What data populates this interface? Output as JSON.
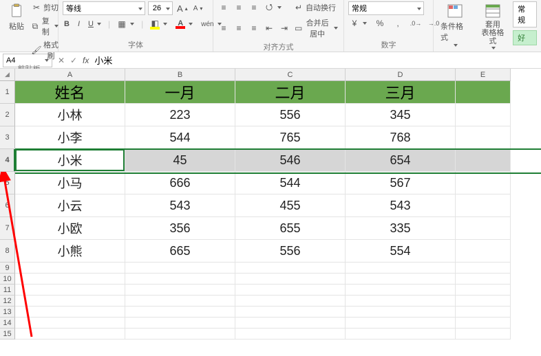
{
  "ribbon": {
    "clipboard": {
      "cut": "剪切",
      "copy": "复制",
      "format_painter": "格式刷",
      "paste": "粘贴",
      "group_label": "剪贴板"
    },
    "font": {
      "name": "等线",
      "size": "26",
      "bold": "B",
      "italic": "I",
      "underline": "U",
      "inc_font_tip": "A",
      "dec_font_tip": "A",
      "group_label": "字体"
    },
    "alignment": {
      "wrap_text": "自动换行",
      "merge_center": "合并后居中",
      "group_label": "对齐方式"
    },
    "number": {
      "format": "常规",
      "group_label": "数字"
    },
    "styles": {
      "cond_format": "条件格式",
      "table_format": "套用\n表格格式",
      "normal": "常规",
      "good": "好",
      "group_label": ""
    }
  },
  "name_box": {
    "ref": "A4",
    "value": "小米"
  },
  "columns": [
    "A",
    "B",
    "C",
    "D",
    "E"
  ],
  "rows": [
    "1",
    "2",
    "3",
    "4",
    "5",
    "6",
    "7",
    "8",
    "9",
    "10",
    "11",
    "12",
    "13",
    "14",
    "15"
  ],
  "chart_data": {
    "type": "table",
    "headers": [
      "姓名",
      "一月",
      "二月",
      "三月"
    ],
    "rows": [
      [
        "小林",
        223,
        556,
        345
      ],
      [
        "小李",
        544,
        765,
        768
      ],
      [
        "小米",
        45,
        546,
        654
      ],
      [
        "小马",
        666,
        544,
        567
      ],
      [
        "小云",
        543,
        455,
        543
      ],
      [
        "小欧",
        356,
        655,
        335
      ],
      [
        "小熊",
        665,
        556,
        554
      ]
    ]
  }
}
